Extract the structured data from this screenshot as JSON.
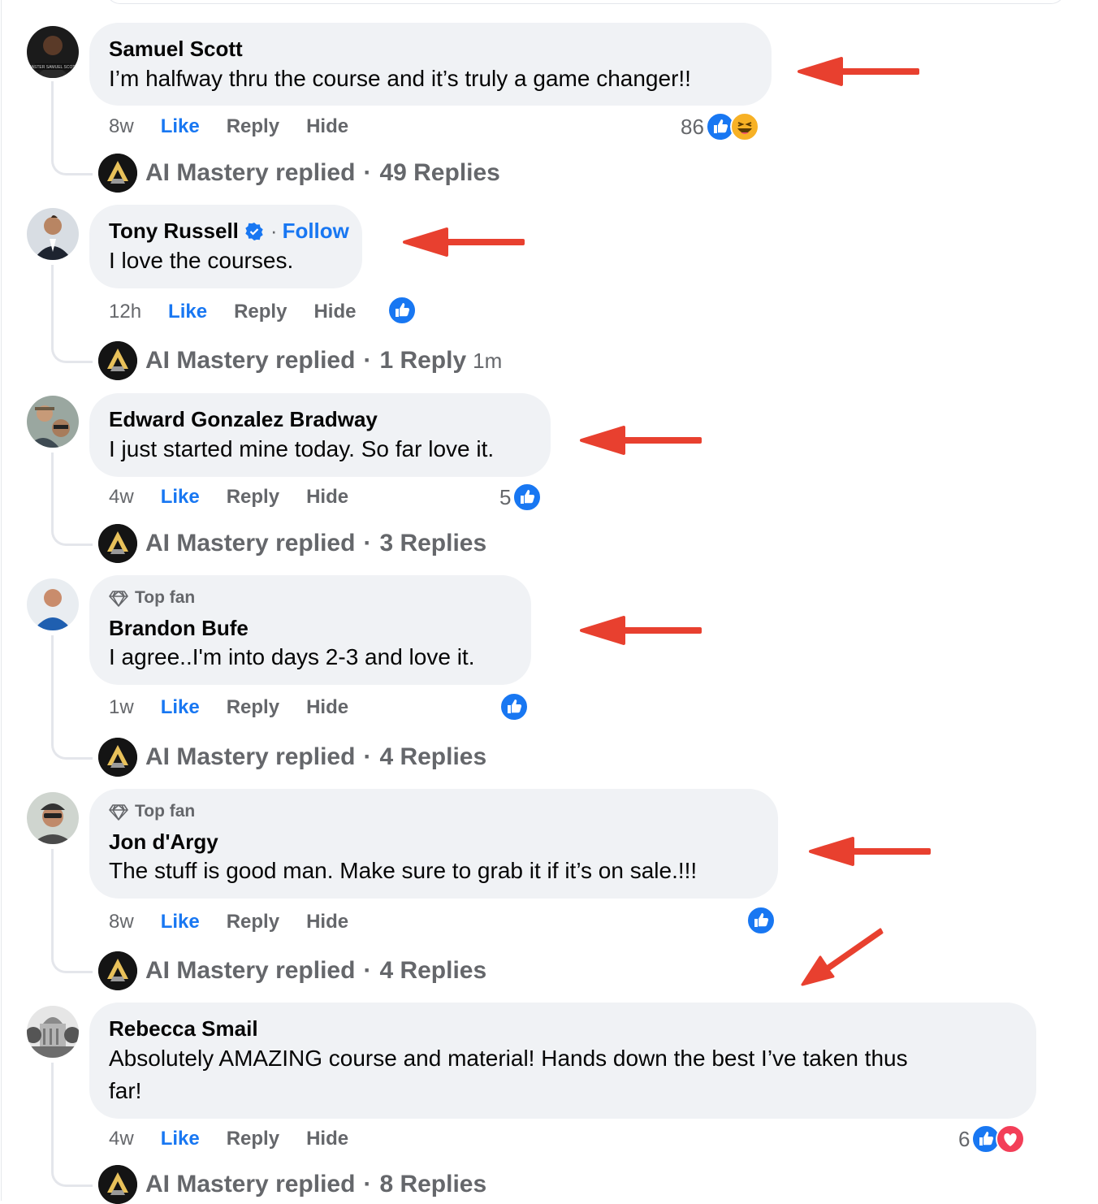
{
  "page_owner": {
    "name": "AI Mastery"
  },
  "colors": {
    "like_blue": "#1877f2",
    "annotation_red": "#e8402f",
    "bubble_bg": "#f0f2f5",
    "meta_gray": "#65676b"
  },
  "labels": {
    "like": "Like",
    "reply": "Reply",
    "hide": "Hide",
    "replied": "AI Mastery replied",
    "follow": "Follow",
    "top_fan": "Top fan",
    "dot": "·"
  },
  "comments": [
    {
      "name": "Samuel Scott",
      "text": "I’m halfway thru the course and it’s truly a game changer!!",
      "time": "8w",
      "reaction_count": "86",
      "reactions": [
        "like-icon",
        "haha-icon"
      ],
      "replies": "49 Replies"
    },
    {
      "name": "Tony Russell",
      "verified": true,
      "text": "I love the courses.",
      "time": "12h",
      "reaction_count": "",
      "reactions": [
        "like-icon"
      ],
      "replies": "1 Reply",
      "reply_ago": "1m"
    },
    {
      "name": "Edward Gonzalez Bradway",
      "text": "I just started mine today. So far love it.",
      "time": "4w",
      "reaction_count": "5",
      "reactions": [
        "like-icon"
      ],
      "replies": "3 Replies"
    },
    {
      "name": "Brandon Bufe",
      "top_fan": true,
      "text": "I agree..I'm into days 2-3 and love it.",
      "time": "1w",
      "reaction_count": "",
      "reactions": [
        "like-icon"
      ],
      "replies": "4 Replies"
    },
    {
      "name": "Jon d'Argy",
      "top_fan": true,
      "text": "The stuff is good man. Make sure to grab it if it’s on sale.!!!",
      "time": "8w",
      "reaction_count": "",
      "reactions": [
        "like-icon"
      ],
      "replies": "4 Replies"
    },
    {
      "name": "Rebecca Smail",
      "text_line1": "Absolutely AMAZING course and material! Hands down the best I’ve taken thus",
      "text_line2": "far!",
      "time": "4w",
      "reaction_count": "6",
      "reactions": [
        "like-icon",
        "love-icon"
      ],
      "replies": "8 Replies"
    }
  ]
}
